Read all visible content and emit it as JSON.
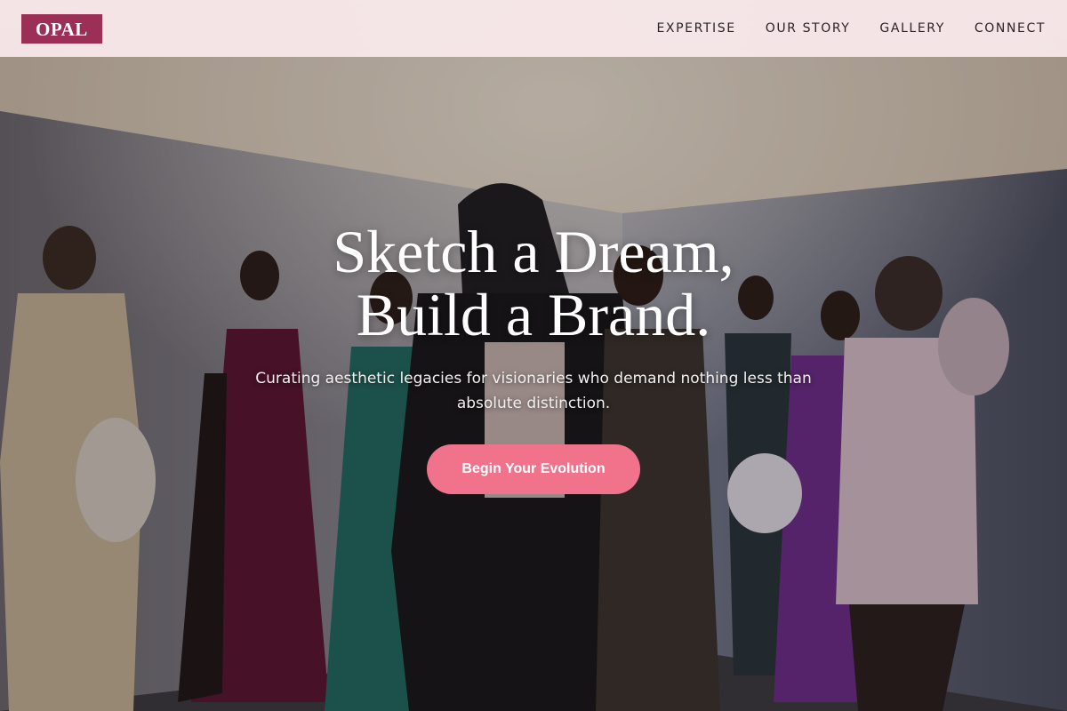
{
  "brand": {
    "logo_text": "OPAL",
    "logo_color": "#9c2f55"
  },
  "nav": {
    "items": [
      {
        "label": "EXPERTISE"
      },
      {
        "label": "OUR STORY"
      },
      {
        "label": "GALLERY"
      },
      {
        "label": "CONNECT"
      }
    ]
  },
  "hero": {
    "headline_line1": "Sketch a Dream,",
    "headline_line2": "Build a Brand.",
    "subtitle": "Curating aesthetic legacies for visionaries who demand nothing less than absolute distinction.",
    "cta_label": "Begin Your Evolution",
    "cta_color": "#f0738b",
    "background_image": "fashion-group-photo"
  }
}
